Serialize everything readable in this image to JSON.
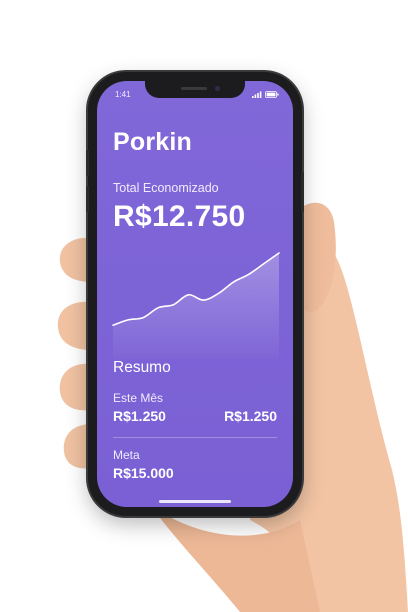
{
  "status_bar": {
    "time": "1:41"
  },
  "app": {
    "title": "Porkin"
  },
  "savings": {
    "label": "Total Economizado",
    "amount": "R$12.750"
  },
  "chart_data": {
    "type": "line",
    "title": "",
    "xlabel": "",
    "ylabel": "",
    "grid": false,
    "x": [
      1,
      2,
      3,
      4,
      5,
      6,
      7,
      8,
      9,
      10,
      11,
      12
    ],
    "y": [
      0.05,
      0.12,
      0.15,
      0.28,
      0.32,
      0.45,
      0.38,
      0.47,
      0.62,
      0.72,
      0.86,
      1.0
    ],
    "ylim": [
      0,
      1
    ]
  },
  "summary": {
    "title": "Resumo",
    "this_month": {
      "label": "Este Mês",
      "value_left": "R$1.250",
      "value_right": "R$1.250"
    },
    "goal": {
      "label": "Meta",
      "value": "R$15.000"
    }
  },
  "colors": {
    "accent": "#7c63d6",
    "text": "#ffffff"
  }
}
